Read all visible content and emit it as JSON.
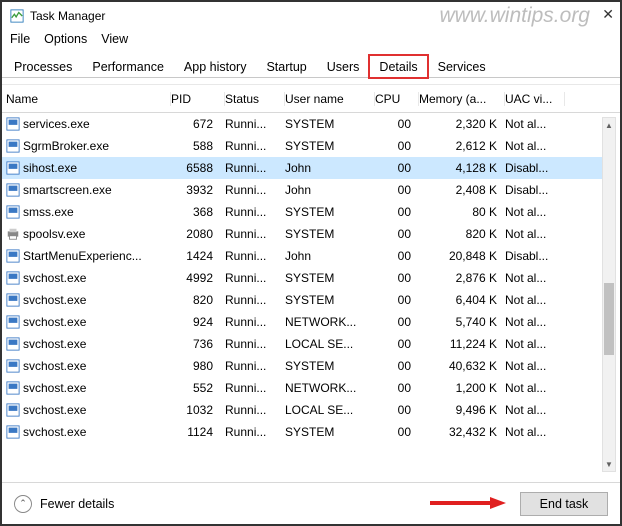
{
  "window": {
    "title": "Task Manager",
    "watermark": "www.wintips.org"
  },
  "menu": {
    "file": "File",
    "options": "Options",
    "view": "View"
  },
  "tabs": [
    {
      "label": "Processes"
    },
    {
      "label": "Performance"
    },
    {
      "label": "App history"
    },
    {
      "label": "Startup"
    },
    {
      "label": "Users"
    },
    {
      "label": "Details",
      "active": true,
      "highlight": true
    },
    {
      "label": "Services"
    }
  ],
  "columns": {
    "name": "Name",
    "pid": "PID",
    "status": "Status",
    "user": "User name",
    "cpu": "CPU",
    "mem": "Memory (a...",
    "uac": "UAC vi..."
  },
  "rows": [
    {
      "icon": "exe",
      "name": "services.exe",
      "pid": "672",
      "status": "Runni...",
      "user": "SYSTEM",
      "cpu": "00",
      "mem": "2,320 K",
      "uac": "Not al..."
    },
    {
      "icon": "exe",
      "name": "SgrmBroker.exe",
      "pid": "588",
      "status": "Runni...",
      "user": "SYSTEM",
      "cpu": "00",
      "mem": "2,612 K",
      "uac": "Not al..."
    },
    {
      "icon": "exe",
      "name": "sihost.exe",
      "pid": "6588",
      "status": "Runni...",
      "user": "John",
      "cpu": "00",
      "mem": "4,128 K",
      "uac": "Disabl...",
      "selected": true
    },
    {
      "icon": "exe",
      "name": "smartscreen.exe",
      "pid": "3932",
      "status": "Runni...",
      "user": "John",
      "cpu": "00",
      "mem": "2,408 K",
      "uac": "Disabl..."
    },
    {
      "icon": "exe",
      "name": "smss.exe",
      "pid": "368",
      "status": "Runni...",
      "user": "SYSTEM",
      "cpu": "00",
      "mem": "80 K",
      "uac": "Not al..."
    },
    {
      "icon": "printer",
      "name": "spoolsv.exe",
      "pid": "2080",
      "status": "Runni...",
      "user": "SYSTEM",
      "cpu": "00",
      "mem": "820 K",
      "uac": "Not al..."
    },
    {
      "icon": "exe",
      "name": "StartMenuExperienc...",
      "pid": "1424",
      "status": "Runni...",
      "user": "John",
      "cpu": "00",
      "mem": "20,848 K",
      "uac": "Disabl..."
    },
    {
      "icon": "exe",
      "name": "svchost.exe",
      "pid": "4992",
      "status": "Runni...",
      "user": "SYSTEM",
      "cpu": "00",
      "mem": "2,876 K",
      "uac": "Not al..."
    },
    {
      "icon": "exe",
      "name": "svchost.exe",
      "pid": "820",
      "status": "Runni...",
      "user": "SYSTEM",
      "cpu": "00",
      "mem": "6,404 K",
      "uac": "Not al..."
    },
    {
      "icon": "exe",
      "name": "svchost.exe",
      "pid": "924",
      "status": "Runni...",
      "user": "NETWORK...",
      "cpu": "00",
      "mem": "5,740 K",
      "uac": "Not al..."
    },
    {
      "icon": "exe",
      "name": "svchost.exe",
      "pid": "736",
      "status": "Runni...",
      "user": "LOCAL SE...",
      "cpu": "00",
      "mem": "11,224 K",
      "uac": "Not al..."
    },
    {
      "icon": "exe",
      "name": "svchost.exe",
      "pid": "980",
      "status": "Runni...",
      "user": "SYSTEM",
      "cpu": "00",
      "mem": "40,632 K",
      "uac": "Not al..."
    },
    {
      "icon": "exe",
      "name": "svchost.exe",
      "pid": "552",
      "status": "Runni...",
      "user": "NETWORK...",
      "cpu": "00",
      "mem": "1,200 K",
      "uac": "Not al..."
    },
    {
      "icon": "exe",
      "name": "svchost.exe",
      "pid": "1032",
      "status": "Runni...",
      "user": "LOCAL SE...",
      "cpu": "00",
      "mem": "9,496 K",
      "uac": "Not al..."
    },
    {
      "icon": "exe",
      "name": "svchost.exe",
      "pid": "1124",
      "status": "Runni...",
      "user": "SYSTEM",
      "cpu": "00",
      "mem": "32,432 K",
      "uac": "Not al..."
    }
  ],
  "footer": {
    "fewer": "Fewer details",
    "end_task": "End task"
  }
}
